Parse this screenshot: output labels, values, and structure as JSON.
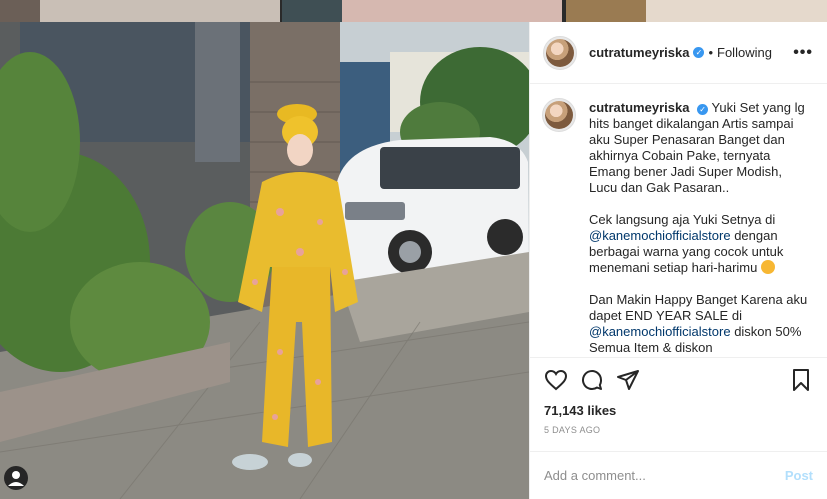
{
  "backdrop": {
    "label": ""
  },
  "post": {
    "username": "cutratumeyriska",
    "verified_mark": "✓",
    "dot": "•",
    "follow_label": "Following",
    "more_label": "•••",
    "caption_user": "cutratumeyriska",
    "caption_p1": "Yuki Set yang lg hits banget dikalangan Artis sampai aku Super Penasaran Banget dan akhirnya Cobain Pake, ternyata Emang bener Jadi Super Modish, Lucu dan Gak Pasaran..",
    "caption_p2_pre": "Cek langsung aja Yuki Setnya di",
    "caption_mention1": "@kanemochiofficialstore",
    "caption_p2_post": " dengan berbagai warna yang cocok untuk menemani setiap hari-harimu ",
    "caption_p3_pre": "Dan Makin Happy Banget Karena aku dapet END YEAR SALE di",
    "caption_mention2": "@kanemochiofficialstore",
    "caption_p3_post": " diskon 50% Semua Item & diskon",
    "likes": "71,143 likes",
    "time_ago": "5 DAYS AGO",
    "comment_placeholder": "Add a comment...",
    "post_button": "Post"
  },
  "icons": {
    "like": "heart-icon",
    "comment": "comment-bubble-icon",
    "share": "paper-plane-icon",
    "save": "bookmark-icon",
    "user_tag": "user-silhouette-icon"
  },
  "colors": {
    "link": "#00376b",
    "verified": "#3897f0",
    "post_disabled": "#b2dffc"
  }
}
